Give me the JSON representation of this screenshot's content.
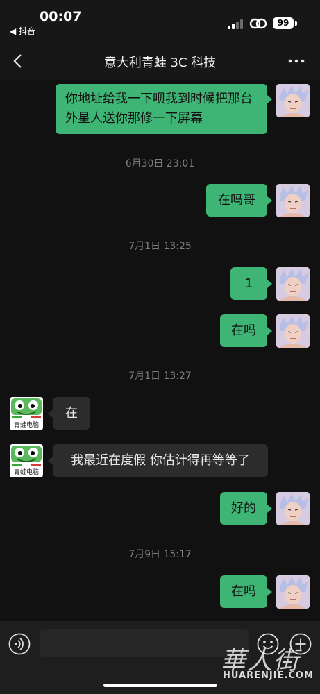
{
  "status_bar": {
    "time": "00:07",
    "back_app": "◀ 抖音",
    "battery": "99"
  },
  "nav": {
    "title": "意大利青蛙 3C 科技"
  },
  "frog_avatar_text": "青蛙电脑",
  "messages": [
    {
      "side": "right",
      "text": "你地址给我一下呗我到时候把那台外星人送你那修一下屏幕"
    },
    {
      "side": "stamp",
      "text": "6月30日 23:01"
    },
    {
      "side": "right",
      "text": "在吗哥"
    },
    {
      "side": "stamp",
      "text": "7月1日 13:25"
    },
    {
      "side": "right",
      "text": "1"
    },
    {
      "side": "right",
      "text": "在吗"
    },
    {
      "side": "stamp",
      "text": "7月1日 13:27"
    },
    {
      "side": "left",
      "text": "在"
    },
    {
      "side": "left",
      "text": "我最近在度假 你估计得再等等了"
    },
    {
      "side": "right",
      "text": "好的"
    },
    {
      "side": "stamp",
      "text": "7月9日 15:17"
    },
    {
      "side": "right",
      "text": "在吗"
    }
  ],
  "input": {
    "voice_icon": "voice-icon",
    "emoji_icon": "emoji-icon",
    "add_icon": "plus-icon"
  },
  "watermark": {
    "cn": "華人街",
    "en": "HUARENJIE.COM"
  },
  "colors": {
    "bubble_mine": "#3eb575",
    "bubble_other": "#2c2c2c",
    "background": "#111111"
  }
}
